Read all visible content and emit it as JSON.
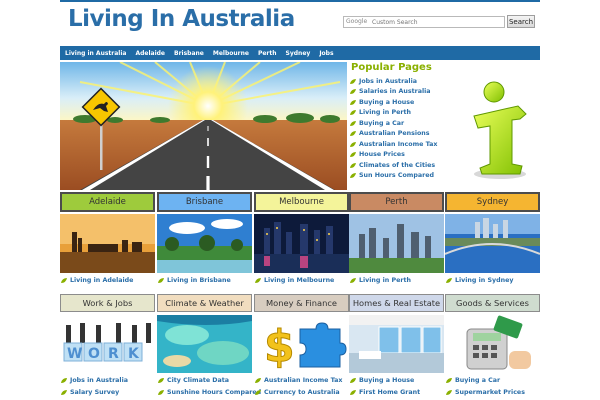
{
  "header": {
    "title": "Living In Australia",
    "search_placeholder": "Custom Search",
    "search_brand": "Google",
    "search_button": "Search"
  },
  "nav": {
    "items": [
      "Living in Australia",
      "Adelaide",
      "Brisbane",
      "Melbourne",
      "Perth",
      "Sydney",
      "Jobs"
    ]
  },
  "popular": {
    "title": "Popular Pages",
    "items": [
      "Jobs in Australia",
      "Salaries in Australia",
      "Buying a House",
      "Living in Perth",
      "Buying a Car",
      "Australian Pensions",
      "Australian Income Tax",
      "House Prices",
      "Climates of the Cities",
      "Sun Hours Compared"
    ]
  },
  "cities": [
    {
      "name": "Adelaide",
      "link": "Living in Adelaide",
      "color": "#9ecb3c"
    },
    {
      "name": "Brisbane",
      "link": "Living in Brisbane",
      "color": "#6db3f2"
    },
    {
      "name": "Melbourne",
      "link": "Living in Melbourne",
      "color": "#f4f49a"
    },
    {
      "name": "Perth",
      "link": "Living in Perth",
      "color": "#c98a63"
    },
    {
      "name": "Sydney",
      "link": "Living in Sydney",
      "color": "#f5b531"
    }
  ],
  "topics": [
    {
      "name": "Work & Jobs",
      "links": [
        "Jobs in Australia",
        "Salary Survey"
      ],
      "color": "#e6e6cc"
    },
    {
      "name": "Climate & Weather",
      "links": [
        "City Climate Data",
        "Sunshine Hours Compared"
      ],
      "color": "#f1ddbf"
    },
    {
      "name": "Money & Finance",
      "links": [
        "Australian Income Tax",
        "Currency to Australia"
      ],
      "color": "#d8cdc0"
    },
    {
      "name": "Homes & Real Estate",
      "links": [
        "Buying a House",
        "First Home Grant"
      ],
      "color": "#cfd8ea"
    },
    {
      "name": "Goods & Services",
      "links": [
        "Buying a Car",
        "Supermarket Prices"
      ],
      "color": "#cfdccf"
    }
  ],
  "colors": {
    "brand_blue": "#1f6aa5",
    "link_blue": "#2a6ea8",
    "popular_green": "#8ab000"
  }
}
